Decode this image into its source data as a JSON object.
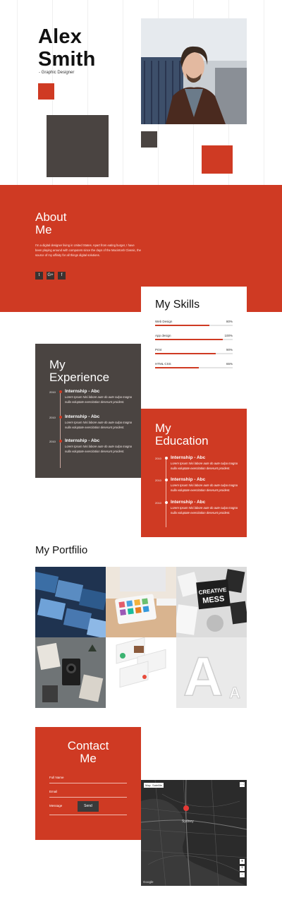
{
  "hero": {
    "first_name": "Alex",
    "last_name": "Smith",
    "role": "- Graphic Designer"
  },
  "about": {
    "title_line1": "About",
    "title_line2": "Me",
    "text": "I'm a digital designer living in United States. Apart from eating burger, I have been playing around with computers since the days of the Macintosh Classic, the source of my affinity for all things digital solutions.",
    "social": [
      {
        "icon": "twitter-icon",
        "glyph": "t"
      },
      {
        "icon": "google-plus-icon",
        "glyph": "G+"
      },
      {
        "icon": "facebook-icon",
        "glyph": "f"
      }
    ]
  },
  "skills": {
    "title": "My Skills",
    "items": [
      {
        "name": "Web Design",
        "percent_label": "80%",
        "value": 80
      },
      {
        "name": "App design",
        "percent_label": "100%",
        "value": 100
      },
      {
        "name": "Print",
        "percent_label": "90%",
        "value": 90
      },
      {
        "name": "HTML CSS",
        "percent_label": "65%",
        "value": 65
      }
    ]
  },
  "experience": {
    "title_line1": "My",
    "title_line2": "Experience",
    "items": [
      {
        "year": "2010",
        "title": "Internship - Abc",
        "desc": "Lorem Ipsum Nisi labore aute do aute culpa magna nulla voluptate exercitation deserunt proident."
      },
      {
        "year": "2010",
        "title": "Internship - Abc",
        "desc": "Lorem Ipsum Nisi labore aute do aute culpa magna nulla voluptate exercitation deserunt proident."
      },
      {
        "year": "2010",
        "title": "Internship - Abc",
        "desc": "Lorem Ipsum Nisi labore aute do aute culpa magna nulla voluptate exercitation deserunt proident."
      }
    ]
  },
  "education": {
    "title_line1": "My",
    "title_line2": "Education",
    "items": [
      {
        "year": "2010",
        "title": "Internship - Abc",
        "desc": "Lorem Ipsum Nisi labore aute do aute culpa magna nulla voluptate exercitation deserunt proident."
      },
      {
        "year": "2010",
        "title": "Internship - Abc",
        "desc": "Lorem Ipsum Nisi labore aute do aute culpa magna nulla voluptate exercitation deserunt proident."
      },
      {
        "year": "2010",
        "title": "Internship - Abc",
        "desc": "Lorem Ipsum Nisi labore aute do aute culpa magna nulla voluptate exercitation deserunt proident."
      }
    ]
  },
  "portfolio": {
    "title": "My Portfilio",
    "tiles": [
      {
        "name": "portfolio-photo-cards"
      },
      {
        "name": "portfolio-imac-tablet"
      },
      {
        "name": "portfolio-creative-mess"
      },
      {
        "name": "portfolio-vintage-camera"
      },
      {
        "name": "portfolio-app-screens"
      },
      {
        "name": "portfolio-letter-a"
      }
    ],
    "creative_text": "CREATIVE MESS",
    "letter": "A"
  },
  "contact": {
    "title_line1": "Contact",
    "title_line2": "Me",
    "fields": [
      {
        "label": "Full Name"
      },
      {
        "label": "Email"
      },
      {
        "label": "Message"
      }
    ],
    "send_label": "Send"
  },
  "map": {
    "tab_map": "Map",
    "tab_satellite": "Satellite",
    "city": "Sydney",
    "google": "Google",
    "zoom_in": "+",
    "zoom_out": "-"
  },
  "colors": {
    "accent": "#cf3a23",
    "dark": "#4a4441"
  }
}
